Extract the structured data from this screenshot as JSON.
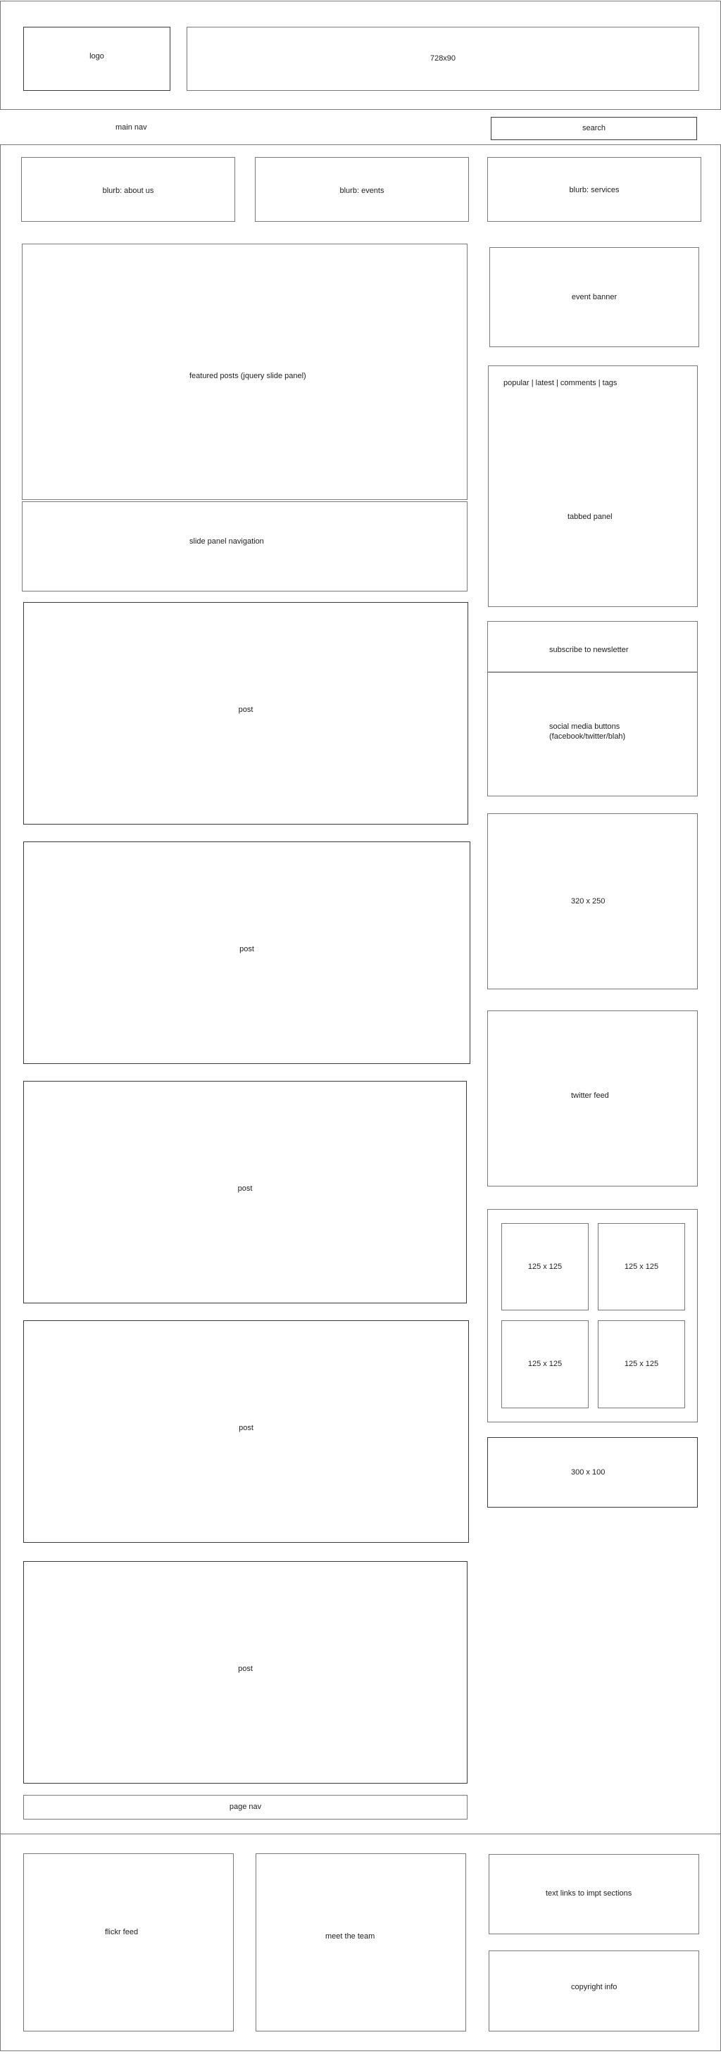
{
  "header": {
    "logo_label": "logo",
    "leaderboard_label": "728x90"
  },
  "nav": {
    "main_nav_label": "main nav",
    "search_label": "search"
  },
  "blurbs": [
    {
      "label": "blurb: about us"
    },
    {
      "label": "blurb: events"
    },
    {
      "label": "blurb: services"
    }
  ],
  "main": {
    "featured_label": "featured posts (jquery slide panel)",
    "slide_nav_label": "slide panel navigation",
    "posts": [
      {
        "label": "post"
      },
      {
        "label": "post"
      },
      {
        "label": "post"
      },
      {
        "label": "post"
      },
      {
        "label": "post"
      }
    ],
    "page_nav_label": "page nav"
  },
  "sidebar": {
    "event_banner_label": "event banner",
    "tabbed_panel": {
      "tabs": [
        "popular",
        "latest",
        "comments",
        "tags"
      ],
      "tabs_text": "popular | latest | comments | tags",
      "label": "tabbed panel"
    },
    "subscribe_label": "subscribe to newsletter",
    "social_label_line1": "social media buttons",
    "social_label_line2": "(facebook/twitter/blah)",
    "ad_320_label": "320 x 250",
    "twitter_label": "twitter feed",
    "ads_125": [
      {
        "label": "125 x 125"
      },
      {
        "label": "125 x 125"
      },
      {
        "label": "125 x 125"
      },
      {
        "label": "125 x 125"
      }
    ],
    "ad_300_label": "300 x 100"
  },
  "footer": {
    "flickr_label": "flickr feed",
    "team_label": "meet the team",
    "links_label": "text links to impt sections",
    "copyright_label": "copyright info"
  }
}
